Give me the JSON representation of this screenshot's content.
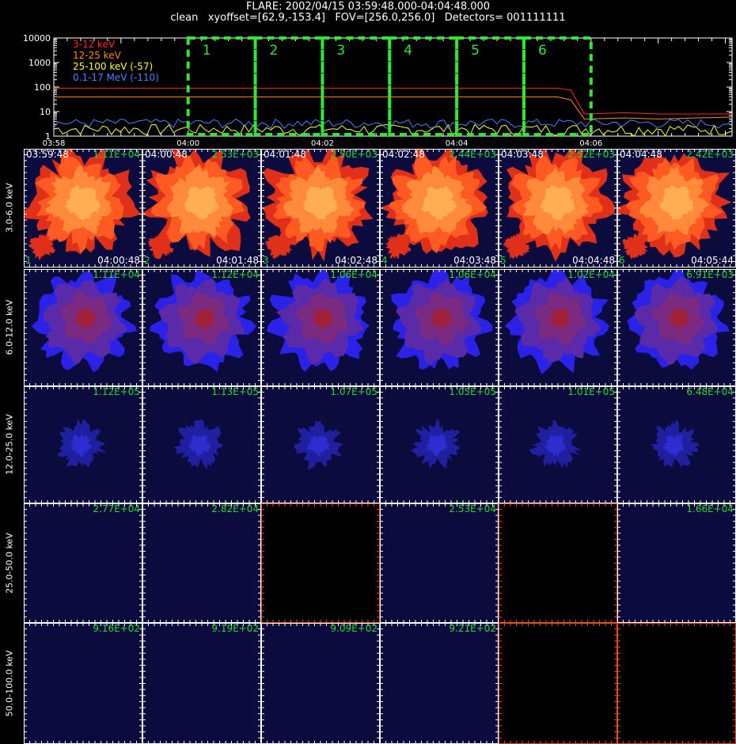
{
  "header": {
    "line1": "FLARE: 2002/04/15 03:59:48.000-04:04:48.000",
    "line2": "clean   xyoffset=[62.9,-153.4]   FOV=[256.0,256.0]   Detectors= 001111111"
  },
  "chart_data": [
    {
      "type": "line",
      "yscale": "log",
      "ylim": [
        1,
        10000
      ],
      "y_ticks": [
        "10000",
        "1000",
        "100",
        "10",
        "1"
      ],
      "x_ticks": [
        "03:58",
        "04:00",
        "04:02",
        "04:04",
        "04:06"
      ],
      "xlim_minutes": [
        0,
        10.1
      ],
      "x_tick_minutes": [
        0,
        2,
        4,
        6,
        8
      ],
      "series": [
        {
          "name": "3-12 keV",
          "color": "#ff2a1a",
          "points": [
            [
              0,
              90
            ],
            [
              2,
              90
            ],
            [
              4,
              90
            ],
            [
              6,
              90
            ],
            [
              7.5,
              90
            ],
            [
              7.7,
              75
            ],
            [
              7.9,
              8
            ],
            [
              8.5,
              9
            ],
            [
              9,
              8
            ],
            [
              10.1,
              8
            ]
          ]
        },
        {
          "name": "12-25 keV",
          "color": "#ff8a1a",
          "points": [
            [
              0,
              40
            ],
            [
              2,
              40
            ],
            [
              4,
              40
            ],
            [
              6,
              40
            ],
            [
              7.5,
              40
            ],
            [
              7.7,
              30
            ],
            [
              7.9,
              5
            ],
            [
              8.5,
              5.5
            ],
            [
              9,
              5
            ],
            [
              10.1,
              6
            ]
          ]
        },
        {
          "name": "25-100 keV (-57)",
          "color": "#ffff33",
          "noise_range": [
            1,
            3
          ]
        },
        {
          "name": "0.1-17 MeV (-110)",
          "color": "#4d7fff",
          "noise_range": [
            2,
            5
          ]
        }
      ],
      "intervals": [
        {
          "label": "1",
          "start": 2.0,
          "end": 3.0
        },
        {
          "label": "2",
          "start": 3.0,
          "end": 4.0
        },
        {
          "label": "3",
          "start": 4.0,
          "end": 5.0
        },
        {
          "label": "4",
          "start": 5.0,
          "end": 6.0
        },
        {
          "label": "5",
          "start": 6.0,
          "end": 7.0
        },
        {
          "label": "6",
          "start": 7.0,
          "end": 8.0
        }
      ]
    }
  ],
  "image_grid": {
    "rows": [
      {
        "label": "3.0-6.0 keV",
        "style": "hot",
        "cells": [
          {
            "tl": "03:59:48",
            "tr": "1.11E+04",
            "bl": "1",
            "br": "04:00:48"
          },
          {
            "tl": "04:00:48",
            "tr": "2.53E+03",
            "bl": "2",
            "br": "04:01:48"
          },
          {
            "tl": "04:01:48",
            "tr": "2.50E+03",
            "bl": "3",
            "br": "04:02:48"
          },
          {
            "tl": "04:02:48",
            "tr": "2.44E+03",
            "bl": "4",
            "br": "04:03:48"
          },
          {
            "tl": "04:03:48",
            "tr": "2.52E+03",
            "bl": "5",
            "br": "04:04:48"
          },
          {
            "tl": "04:04:48",
            "tr": "2.42E+03",
            "bl": "6",
            "br": "04:05:44"
          }
        ]
      },
      {
        "label": "6.0-12.0 keV",
        "style": "blob",
        "cells": [
          {
            "tr": "1.11E+04"
          },
          {
            "tr": "1.12E+04"
          },
          {
            "tr": "1.06E+04"
          },
          {
            "tr": "1.06E+04"
          },
          {
            "tr": "1.02E+04"
          },
          {
            "tr": "6.91E+03"
          }
        ]
      },
      {
        "label": "12.0-25.0 keV",
        "style": "faint",
        "cells": [
          {
            "tr": "1.12E+05"
          },
          {
            "tr": "1.13E+05"
          },
          {
            "tr": "1.07E+05"
          },
          {
            "tr": "1.05E+05"
          },
          {
            "tr": "1.01E+05"
          },
          {
            "tr": "6.48E+04"
          }
        ]
      },
      {
        "label": "25.0-50.0 keV",
        "style": "empty",
        "cells": [
          {
            "tr": "2.77E+04"
          },
          {
            "tr": "2.82E+04"
          },
          {
            "blank": true
          },
          {
            "tr": "2.53E+04"
          },
          {
            "blank": true
          },
          {
            "tr": "1.66E+04"
          }
        ]
      },
      {
        "label": "50.0-100.0 keV",
        "style": "empty",
        "cells": [
          {
            "tr": "9.16E+02"
          },
          {
            "tr": "9.19E+02"
          },
          {
            "tr": "9.09E+02"
          },
          {
            "tr": "9.21E+02"
          },
          {
            "blank": true
          },
          {
            "blank": true
          }
        ]
      }
    ]
  }
}
